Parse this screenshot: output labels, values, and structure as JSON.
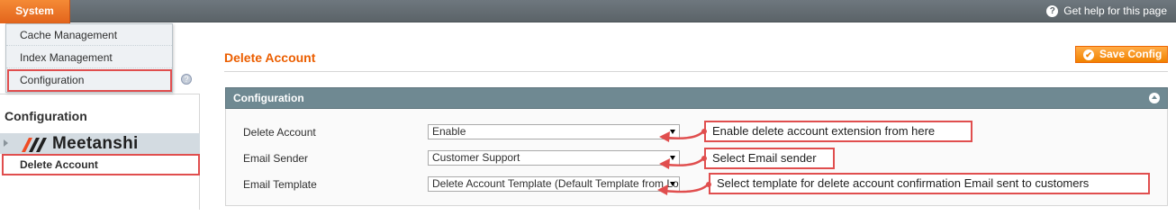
{
  "topnav": {
    "menu_label": "System",
    "help_label": "Get help for this page",
    "help_icon": "help-icon"
  },
  "dropdown": {
    "items": [
      {
        "label": "Cache Management"
      },
      {
        "label": "Index Management"
      },
      {
        "label": "Configuration"
      }
    ]
  },
  "sidebar": {
    "heading": "Configuration",
    "tab_group_brand": "Meetanshi",
    "brand_logo": "meetanshi-logo",
    "active_item": "Delete Account"
  },
  "main": {
    "page_title": "Delete Account",
    "save_label": "Save Config",
    "section_title": "Configuration",
    "fields": [
      {
        "label": "Delete Account",
        "value": "Enable"
      },
      {
        "label": "Email Sender",
        "value": "Customer Support"
      },
      {
        "label": "Email Template",
        "value": "Delete Account Template (Default Template from Locale)"
      }
    ]
  },
  "annotations": [
    {
      "text": "Enable delete account extension from here"
    },
    {
      "text": "Select Email sender"
    },
    {
      "text": "Select template for delete account confirmation Email sent to customers"
    }
  ],
  "colors": {
    "accent_orange": "#eb5e00",
    "annotation_red": "#e04e4e",
    "section_header": "#6f8992",
    "nav_bar": "#5b6368"
  }
}
